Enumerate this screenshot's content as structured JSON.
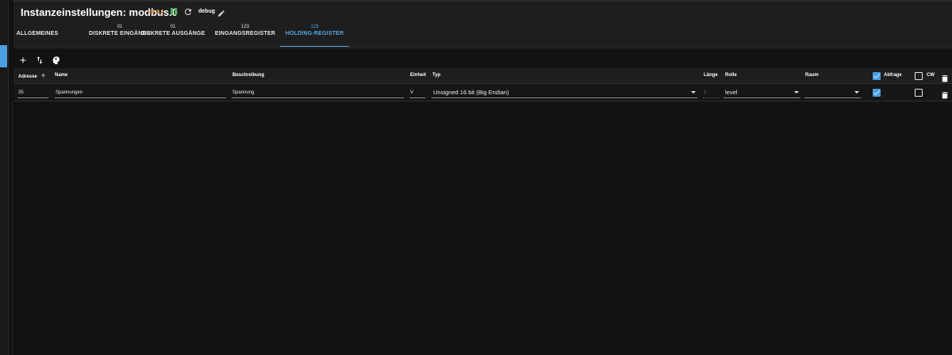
{
  "header": {
    "title": "Instanzeinstellungen: modbus.0",
    "version": "v6.3.2",
    "log_level": "debug"
  },
  "tabs": [
    {
      "sub": "",
      "label": "ALLGEMEINES",
      "active": false
    },
    {
      "sub": "01",
      "label": "DISKRETE EINGÄNGE",
      "active": false
    },
    {
      "sub": "01",
      "label": "DISKRETE AUSGÄNGE",
      "active": false
    },
    {
      "sub": "123",
      "label": "EINGANGSREGISTER",
      "active": false
    },
    {
      "sub": "123",
      "label": "HOLDING-REGISTER",
      "active": true
    }
  ],
  "toolbar": {
    "icons": [
      "add-icon",
      "sort-icon",
      "import-icon"
    ]
  },
  "table": {
    "columns": {
      "address": "Adresse",
      "name": "Name",
      "description": "Beschreibung",
      "unit": "Einheit",
      "type": "Typ",
      "length": "Länge",
      "role": "Rolle",
      "room": "Raum",
      "poll": "Abfrage",
      "cw": "CW"
    },
    "sort": {
      "column": "address",
      "direction": "asc"
    },
    "header_checkboxes": {
      "poll": true,
      "cw": false
    },
    "rows": [
      {
        "address": "35",
        "name": "Spannungen",
        "description": "Spannung",
        "unit": "V",
        "type": "Unsigned 16 bit (Big Endian)",
        "length": "1",
        "role": "level",
        "room": "",
        "poll": true,
        "cw": false
      }
    ]
  },
  "colors": {
    "accent": "#4a9fe2",
    "version": "#d07a1f",
    "running": "#4bb05a",
    "background": "#121212"
  }
}
